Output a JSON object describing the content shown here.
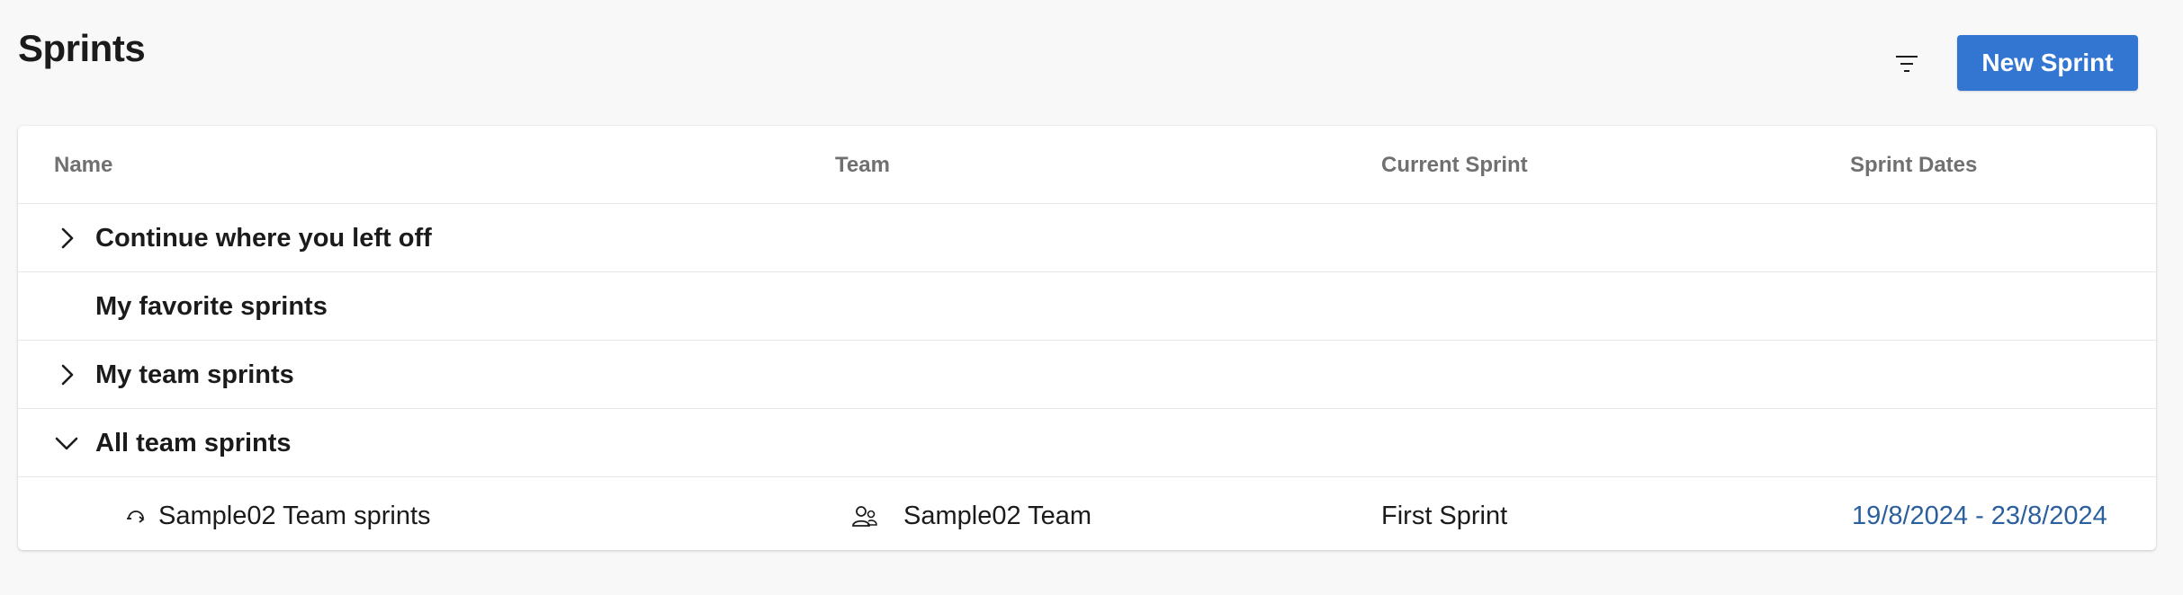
{
  "header": {
    "title": "Sprints",
    "new_sprint_label": "New Sprint"
  },
  "table": {
    "columns": {
      "name": "Name",
      "team": "Team",
      "current_sprint": "Current Sprint",
      "sprint_dates": "Sprint Dates"
    },
    "groups": [
      {
        "label": "Continue where you left off",
        "state": "collapsed"
      },
      {
        "label": "My favorite sprints",
        "state": "none"
      },
      {
        "label": "My team sprints",
        "state": "collapsed"
      },
      {
        "label": "All team sprints",
        "state": "expanded"
      }
    ],
    "rows": [
      {
        "name": "Sample02 Team sprints",
        "team": "Sample02 Team",
        "current_sprint": "First Sprint",
        "sprint_dates": "19/8/2024 - 23/8/2024"
      }
    ]
  },
  "colors": {
    "accent": "#3376d1",
    "link": "#2b5f9e",
    "background": "#f8f8f8"
  },
  "icons": {
    "filter": "filter-icon",
    "collapsed": "chevron-right-icon",
    "expanded": "chevron-down-icon",
    "sprint": "sprint-icon",
    "team": "team-icon"
  }
}
